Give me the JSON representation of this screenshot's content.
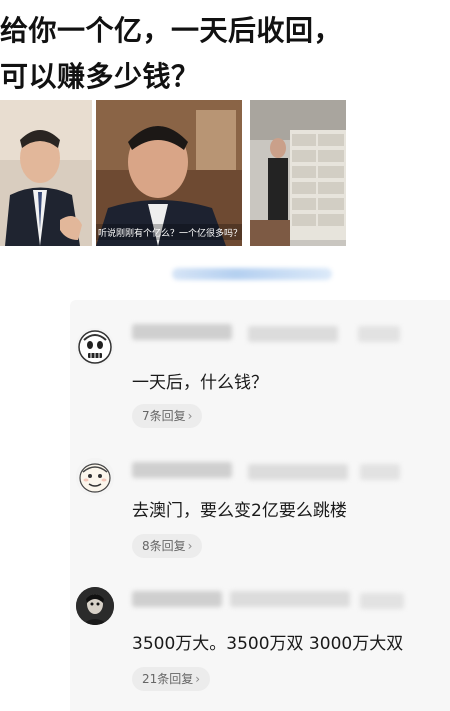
{
  "question": {
    "line1": "给你一个亿，一天后收回，",
    "line2": "可以赚多少钱？"
  },
  "meme": {
    "caption": "听说刚刚有个亿么？一个亿很多吗？"
  },
  "comments": [
    {
      "text": "一天后，什么钱？",
      "reply": "7条回复",
      "avatar": "sketch-face-avatar-icon"
    },
    {
      "text": "去澳门，要么变2亿要么跳楼",
      "reply": "8条回复",
      "avatar": "cartoon-face-avatar-icon"
    },
    {
      "text": "3500万大。3500万双 3000万大双",
      "reply": "21条回复",
      "avatar": "dark-photo-avatar-icon"
    }
  ],
  "colors": {
    "panel_bg": "#f7f7f7",
    "pill_bg": "#ececec",
    "link_blur": "#a8c8ee"
  }
}
